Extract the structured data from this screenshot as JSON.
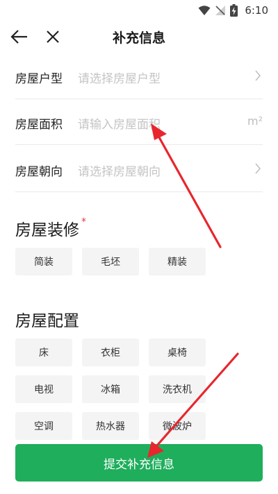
{
  "status_bar": {
    "time": "6:10",
    "icons": [
      "wifi-icon",
      "signal-off-icon",
      "battery-charging-icon"
    ]
  },
  "nav": {
    "title": "补充信息",
    "back_icon": "arrow-left-icon",
    "close_icon": "close-icon"
  },
  "form": {
    "rows": [
      {
        "label": "房屋户型",
        "placeholder": "请选择房屋户型",
        "trail_icon": "chevron-right-icon"
      },
      {
        "label": "房屋面积",
        "placeholder": "请输入房屋面积",
        "unit": "m²"
      },
      {
        "label": "房屋朝向",
        "placeholder": "请选择房屋朝向",
        "trail_icon": "chevron-right-icon"
      }
    ]
  },
  "decoration": {
    "title": "房屋装修",
    "required_mark": "*",
    "options": [
      "简装",
      "毛坯",
      "精装"
    ]
  },
  "config": {
    "title": "房屋配置",
    "options": [
      "床",
      "衣柜",
      "桌椅",
      "电视",
      "冰箱",
      "洗衣机",
      "空调",
      "热水器",
      "微波炉"
    ]
  },
  "submit": {
    "label": "提交补充信息"
  },
  "annotation": {
    "arrow_color": "#e8262d"
  },
  "colors": {
    "accent": "#1fae5c",
    "required": "#e0393e"
  }
}
